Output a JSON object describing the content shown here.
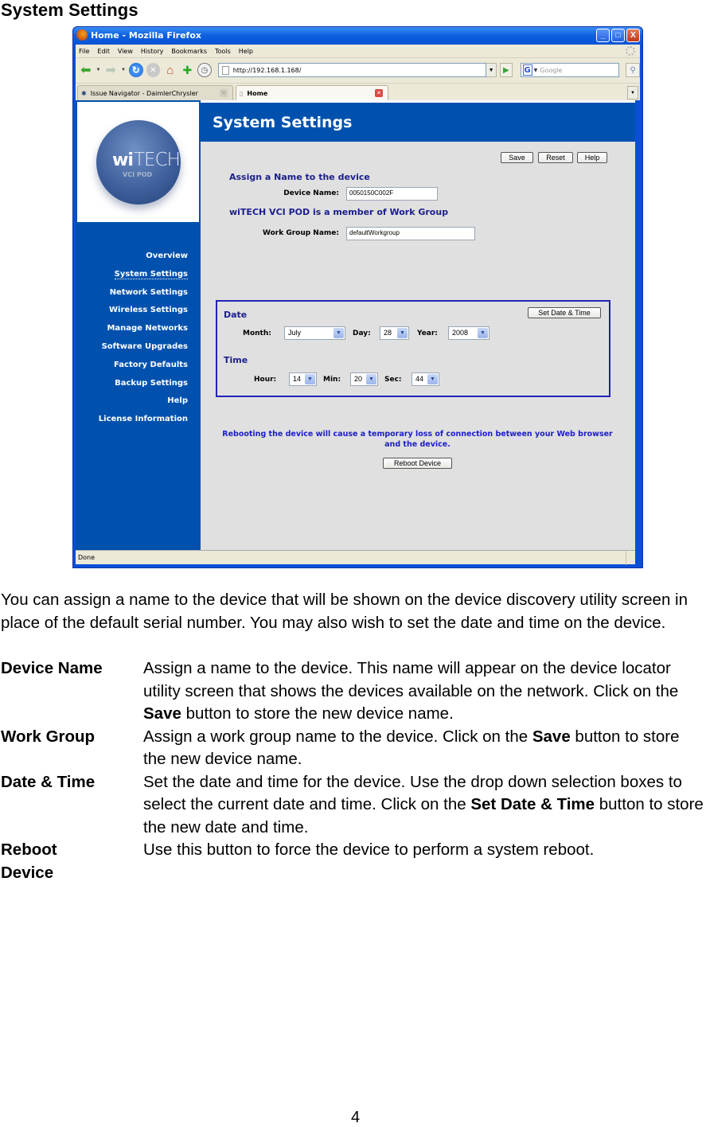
{
  "doc": {
    "heading": "System Settings",
    "intro": "You can assign a name to the device that will be shown on the device discovery utility screen in place of the default serial number.  You may also wish to set the date and time on the device.",
    "definitions": [
      {
        "term": "Device Name",
        "pre": "Assign a name to the device.  This name will appear on the device locator utility screen that shows the devices available on the network.   Click on the ",
        "bold": "Save",
        "post": " button to store the new device name."
      },
      {
        "term": "Work Group",
        "pre": "Assign a work group name to the device.  Click on the ",
        "bold": "Save",
        "post": " button to store the new device name."
      },
      {
        "term": "Date & Time",
        "pre": "Set the date and time for the device.  Use the drop down selection boxes to select the current date and time.  Click on the ",
        "bold": "Set Date & Time",
        "post": " button to store the new date and time."
      },
      {
        "term": "Reboot Device",
        "pre": "Use this button to force the device to perform a system reboot.",
        "bold": "",
        "post": ""
      }
    ],
    "page_number": "4"
  },
  "browser": {
    "window_title": "Home - Mozilla Firefox",
    "window_buttons": {
      "minimize": "_",
      "maximize": "□",
      "close": "X"
    },
    "menu": [
      "File",
      "Edit",
      "View",
      "History",
      "Bookmarks",
      "Tools",
      "Help"
    ],
    "url": "http://192.168.1.168/",
    "search_placeholder": "Google",
    "tabs": [
      {
        "label": "Issue Navigator - DaimlerChrysler",
        "active": false
      },
      {
        "label": "Home",
        "active": true
      }
    ],
    "status": "Done"
  },
  "app": {
    "logo": {
      "wi": "wi",
      "tech": "TECH",
      "sub": "VCI POD"
    },
    "nav": [
      {
        "label": "Overview",
        "current": false
      },
      {
        "label": "System Settings",
        "current": true
      },
      {
        "label": "Network Settings",
        "current": false
      },
      {
        "label": "Wireless Settings",
        "current": false
      },
      {
        "label": "Manage Networks",
        "current": false
      },
      {
        "label": "Software Upgrades",
        "current": false
      },
      {
        "label": "Factory Defaults",
        "current": false
      },
      {
        "label": "Backup Settings",
        "current": false
      },
      {
        "label": "Help",
        "current": false
      },
      {
        "label": "License Information",
        "current": false
      }
    ],
    "page_title": "System Settings",
    "toolbar": {
      "save": "Save",
      "reset": "Reset",
      "help": "Help"
    },
    "name_section": {
      "heading": "Assign a Name to the device",
      "device_name_label": "Device Name:",
      "device_name_value": "0050150C002F"
    },
    "workgroup_section": {
      "heading": "wiTECH VCI POD is a member of Work Group",
      "label": "Work Group Name:",
      "value": "defaultWorkgroup"
    },
    "date_section": {
      "heading": "Date",
      "set_button": "Set Date & Time",
      "month_label": "Month:",
      "month_value": "July",
      "day_label": "Day:",
      "day_value": "28",
      "year_label": "Year:",
      "year_value": "2008"
    },
    "time_section": {
      "heading": "Time",
      "hour_label": "Hour:",
      "hour_value": "14",
      "min_label": "Min:",
      "min_value": "20",
      "sec_label": "Sec:",
      "sec_value": "44"
    },
    "reboot": {
      "message": "Rebooting the device will cause a temporary loss of connection between your Web browser and the device.",
      "button": "Reboot Device"
    }
  },
  "colors": {
    "brand_blue": "#0051ae",
    "heading_navy": "#1b1e8c",
    "reboot_text": "#1b1ec8",
    "content_bg": "#e0e0e0"
  }
}
